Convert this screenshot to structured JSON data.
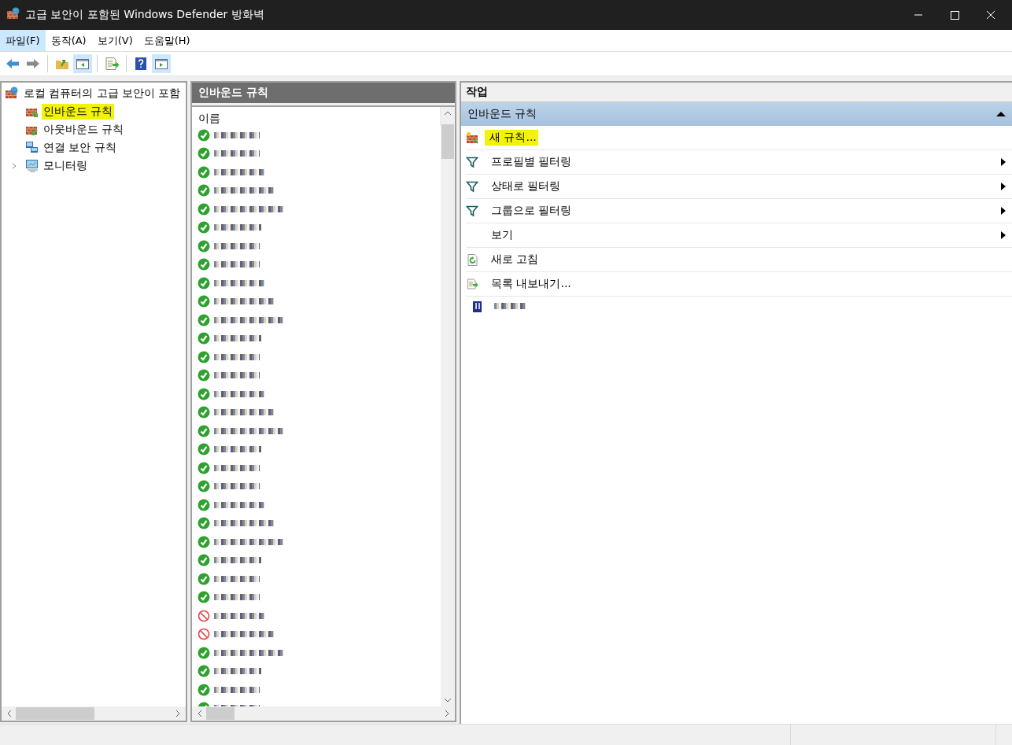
{
  "window": {
    "title": "고급 보안이 포함된 Windows Defender 방화벽"
  },
  "menu": [
    {
      "label": "파일(F)",
      "selected": true
    },
    {
      "label": "동작(A)",
      "selected": false
    },
    {
      "label": "보기(V)",
      "selected": false
    },
    {
      "label": "도움말(H)",
      "selected": false
    }
  ],
  "toolbar": [
    {
      "kind": "back"
    },
    {
      "kind": "forward"
    },
    {
      "kind": "sep"
    },
    {
      "kind": "up",
      "selected": false
    },
    {
      "kind": "tree",
      "selected": true
    },
    {
      "kind": "sep"
    },
    {
      "kind": "export",
      "selected": false
    },
    {
      "kind": "sep"
    },
    {
      "kind": "help",
      "selected": false
    },
    {
      "kind": "actions",
      "selected": true
    }
  ],
  "tree": {
    "root": "로컬 컴퓨터의 고급 보안이 포함",
    "children": [
      {
        "label": "인바운드 규칙",
        "kind": "inbound",
        "highlighted": true
      },
      {
        "label": "아웃바운드 규칙",
        "kind": "outbound",
        "highlighted": false
      },
      {
        "label": "연결 보안 규칙",
        "kind": "connection",
        "highlighted": false
      },
      {
        "label": "모니터링",
        "kind": "monitor",
        "highlighted": false,
        "expanded": false
      }
    ]
  },
  "rules": {
    "title": "인바운드 규칙",
    "column_1": "이름",
    "rows": [
      {
        "kind": "allow"
      },
      {
        "kind": "allow"
      },
      {
        "kind": "allow"
      },
      {
        "kind": "allow"
      },
      {
        "kind": "allow"
      },
      {
        "kind": "allow"
      },
      {
        "kind": "allow"
      },
      {
        "kind": "allow"
      },
      {
        "kind": "allow"
      },
      {
        "kind": "allow"
      },
      {
        "kind": "allow"
      },
      {
        "kind": "allow"
      },
      {
        "kind": "allow"
      },
      {
        "kind": "allow"
      },
      {
        "kind": "allow"
      },
      {
        "kind": "allow"
      },
      {
        "kind": "allow"
      },
      {
        "kind": "allow"
      },
      {
        "kind": "allow"
      },
      {
        "kind": "allow"
      },
      {
        "kind": "allow"
      },
      {
        "kind": "allow"
      },
      {
        "kind": "allow"
      },
      {
        "kind": "allow"
      },
      {
        "kind": "allow"
      },
      {
        "kind": "allow"
      },
      {
        "kind": "block"
      },
      {
        "kind": "block"
      },
      {
        "kind": "allow"
      },
      {
        "kind": "allow"
      },
      {
        "kind": "allow"
      },
      {
        "kind": "allow"
      }
    ]
  },
  "actions": {
    "title": "작업",
    "section": "인바운드 규칙",
    "expanded": true,
    "items": [
      {
        "kind": "new",
        "label": "새 규칙...",
        "highlighted": true,
        "submenu": false
      },
      {
        "kind": "filter",
        "label": "프로필별 필터링",
        "highlighted": false,
        "submenu": true
      },
      {
        "kind": "filter",
        "label": "상태로 필터링",
        "highlighted": false,
        "submenu": true
      },
      {
        "kind": "filter",
        "label": "그룹으로 필터링",
        "highlighted": false,
        "submenu": true
      },
      {
        "kind": "none",
        "label": "보기",
        "highlighted": false,
        "submenu": true
      },
      {
        "kind": "refresh",
        "label": "새로 고침",
        "highlighted": false,
        "submenu": false
      },
      {
        "kind": "export",
        "label": "목록 내보내기...",
        "highlighted": false,
        "submenu": false
      },
      {
        "kind": "redacted"
      }
    ]
  }
}
